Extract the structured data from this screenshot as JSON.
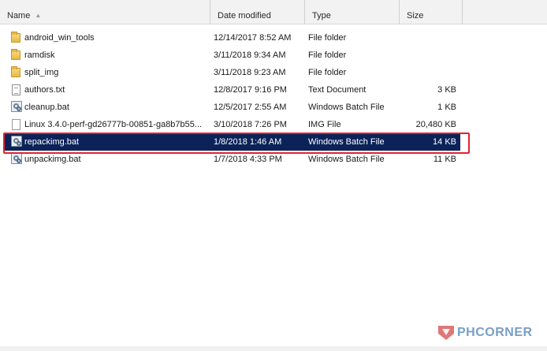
{
  "header": {
    "name_label": "Name",
    "date_label": "Date modified",
    "type_label": "Type",
    "size_label": "Size"
  },
  "files": [
    {
      "icon": "folder-icon",
      "name": "android_win_tools",
      "date": "12/14/2017 8:52 AM",
      "type": "File folder",
      "size": ""
    },
    {
      "icon": "folder-icon",
      "name": "ramdisk",
      "date": "3/11/2018 9:34 AM",
      "type": "File folder",
      "size": ""
    },
    {
      "icon": "folder-icon",
      "name": "split_img",
      "date": "3/11/2018 9:23 AM",
      "type": "File folder",
      "size": ""
    },
    {
      "icon": "text-document-icon",
      "name": "authors.txt",
      "date": "12/8/2017 9:16 PM",
      "type": "Text Document",
      "size": "3 KB"
    },
    {
      "icon": "batch-file-icon",
      "name": "cleanup.bat",
      "date": "12/5/2017 2:55 AM",
      "type": "Windows Batch File",
      "size": "1 KB"
    },
    {
      "icon": "file-icon",
      "name": "Linux 3.4.0-perf-gd26777b-00851-ga8b7b55...",
      "date": "3/10/2018 7:26 PM",
      "type": "IMG File",
      "size": "20,480 KB"
    },
    {
      "icon": "batch-file-icon",
      "name": "repackimg.bat",
      "date": "1/8/2018 1:46 AM",
      "type": "Windows Batch File",
      "size": "14 KB",
      "selected": true
    },
    {
      "icon": "batch-file-icon",
      "name": "unpackimg.bat",
      "date": "1/7/2018 4:33 PM",
      "type": "Windows Batch File",
      "size": "11 KB"
    }
  ],
  "watermark": {
    "text": "PHCORNER"
  },
  "colors": {
    "selection": "#0b2359",
    "highlight_border": "#e0242e"
  }
}
